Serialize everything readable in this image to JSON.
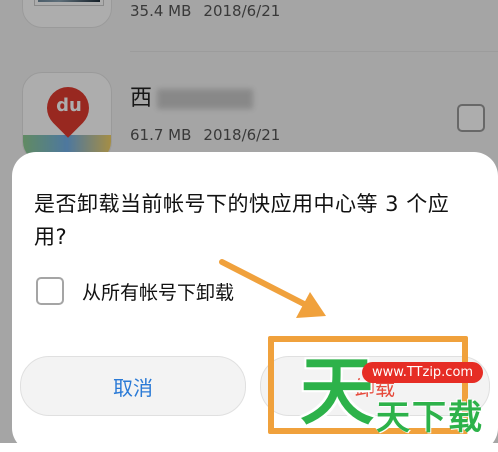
{
  "app_list": [
    {
      "name": "",
      "size": "35.4 MB",
      "date": "2018/6/21"
    },
    {
      "name": "西",
      "icon_text": "du",
      "size": "61.7 MB",
      "date": "2018/6/21"
    }
  ],
  "dialog": {
    "question": "是否卸载当前帐号下的快应用中心等 3 个应用?",
    "option_label": "从所有帐号下卸载",
    "option_checked": false,
    "cancel_label": "取消",
    "uninstall_label": "卸载"
  },
  "watermark": {
    "big_char": "天",
    "url": "www.TTzip.com",
    "small_text": "天下载"
  },
  "colors": {
    "accent_blue": "#2a7ad6",
    "annotation_orange": "#f0a13c",
    "watermark_green": "#2db24a",
    "watermark_red": "#e62d25",
    "baidu_red": "#e13b30"
  },
  "icons": [
    "photo-app-icon",
    "baidu-map-icon",
    "checkbox-icon",
    "arrow-annotation-icon"
  ]
}
